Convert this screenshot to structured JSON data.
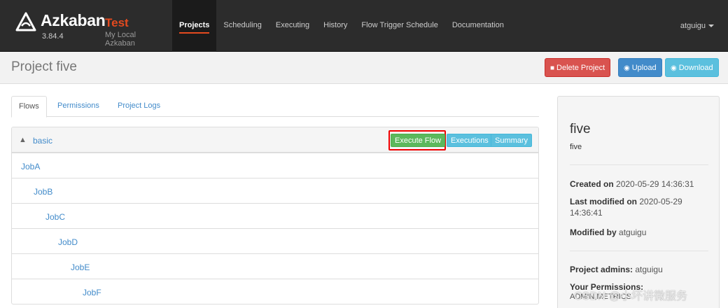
{
  "brand": {
    "name": "Azkaban",
    "env": "Test",
    "version": "3.84.4",
    "subtitle": "My Local Azkaban",
    "logo_icon": "azkaban-logo-icon"
  },
  "nav": {
    "items": [
      "Projects",
      "Scheduling",
      "Executing",
      "History",
      "Flow Trigger Schedule",
      "Documentation"
    ],
    "active": "Projects",
    "user": "atguigu"
  },
  "project": {
    "title": "Project five",
    "delete_label": "Delete Project",
    "upload_label": "Upload",
    "download_label": "Download"
  },
  "tabs": [
    "Flows",
    "Permissions",
    "Project Logs"
  ],
  "flow": {
    "name": "basic",
    "execute_label": "Execute Flow",
    "executions_label": "Executions",
    "summary_label": "Summary",
    "jobs": [
      "JobA",
      "JobB",
      "JobC",
      "JobD",
      "JobE",
      "JobF"
    ]
  },
  "sidebar": {
    "name": "five",
    "description": "five",
    "created_label": "Created on",
    "created_value": "2020-05-29 14:36:31",
    "modified_label": "Last modified on",
    "modified_value": "2020-05-29 14:36:41",
    "modified_by_label": "Modified by",
    "modified_by_value": "atguigu",
    "admins_label": "Project admins:",
    "admins_value": "atguigu",
    "permissions_label": "Your Permissions:",
    "permissions_value": "ADMIN,METRICS"
  },
  "watermark": "CSDN @小坏讲微服务",
  "colors": {
    "navbar": "#2c2c2c",
    "accent": "#e44a1f",
    "link": "#428bca",
    "danger": "#d9534f",
    "success": "#5cb85c",
    "info": "#5bc0de",
    "highlight_box": "#ee0000"
  }
}
